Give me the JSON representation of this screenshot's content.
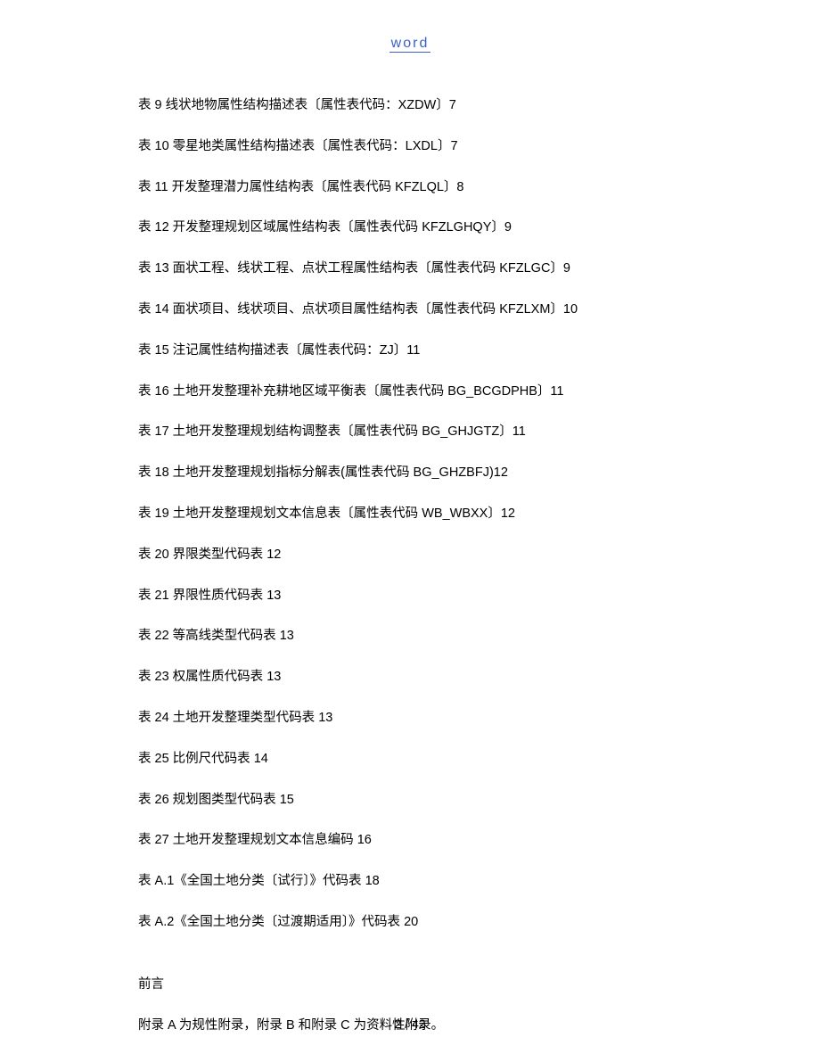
{
  "header": {
    "title": "word"
  },
  "toc": [
    "表 9 线状地物属性结构描述表〔属性表代码：XZDW〕7",
    "表 10 零星地类属性结构描述表〔属性表代码：LXDL〕7",
    "表 11 开发整理潜力属性结构表〔属性表代码 KFZLQL〕8",
    "表 12 开发整理规划区域属性结构表〔属性表代码 KFZLGHQY〕9",
    "表 13 面状工程、线状工程、点状工程属性结构表〔属性表代码 KFZLGC〕9",
    "表 14 面状项目、线状项目、点状项目属性结构表〔属性表代码 KFZLXM〕10",
    "表 15 注记属性结构描述表〔属性表代码：ZJ〕11",
    "表 16 土地开发整理补充耕地区域平衡表〔属性表代码 BG_BCGDPHB〕11",
    "表 17 土地开发整理规划结构调整表〔属性表代码 BG_GHJGTZ〕11",
    "表 18 土地开发整理规划指标分解表(属性表代码 BG_GHZBFJ)12",
    "表 19 土地开发整理规划文本信息表〔属性表代码 WB_WBXX〕12",
    "表 20 界限类型代码表 12",
    "表 21 界限性质代码表 13",
    "表 22 等高线类型代码表 13",
    "表 23 权属性质代码表 13",
    "表 24 土地开发整理类型代码表 13",
    "表 25 比例尺代码表 14",
    "表 26 规划图类型代码表 15",
    "表 27 土地开发整理规划文本信息编码 16",
    "表 A.1《全国土地分类〔试行〕》代码表 18",
    "表 A.2《全国土地分类〔过渡期适用〕》代码表 20"
  ],
  "preface": {
    "heading": "前言",
    "body": "附录 A 为规性附录，附录 B 和附录 C 为资料性附录。"
  },
  "footer": {
    "page": "2 / 42"
  }
}
